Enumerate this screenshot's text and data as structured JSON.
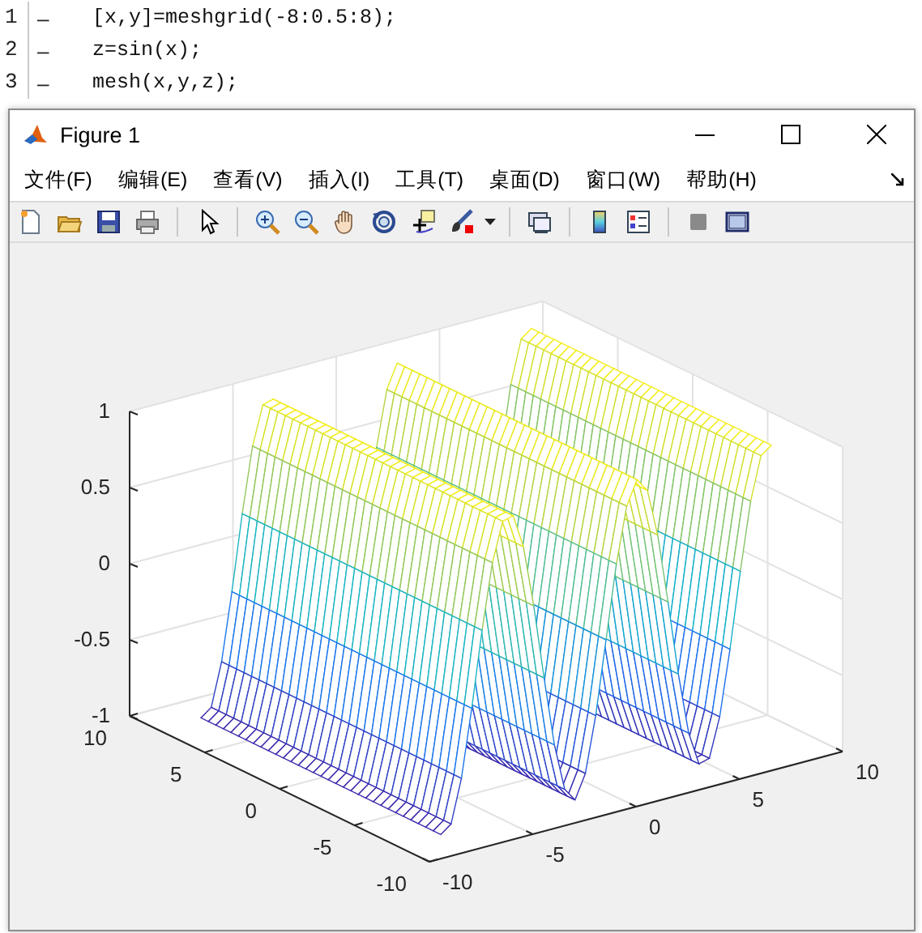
{
  "editor": {
    "lines": [
      {
        "number": "1",
        "marker": "–",
        "code": "[x,y]=meshgrid(-8:0.5:8);"
      },
      {
        "number": "2",
        "marker": "–",
        "code": "z=sin(x);"
      },
      {
        "number": "3",
        "marker": "–",
        "code": "mesh(x,y,z);"
      }
    ]
  },
  "figure": {
    "title": "Figure 1",
    "menus": [
      "文件(F)",
      "编辑(E)",
      "查看(V)",
      "插入(I)",
      "工具(T)",
      "桌面(D)",
      "窗口(W)",
      "帮助(H)"
    ],
    "axes": {
      "z_ticks": [
        "1",
        "0.5",
        "0",
        "-0.5",
        "-1"
      ],
      "y_ticks": [
        "10",
        "5",
        "0",
        "-5",
        "-10"
      ],
      "x_ticks": [
        "-10",
        "-5",
        "0",
        "5",
        "10"
      ]
    }
  }
}
